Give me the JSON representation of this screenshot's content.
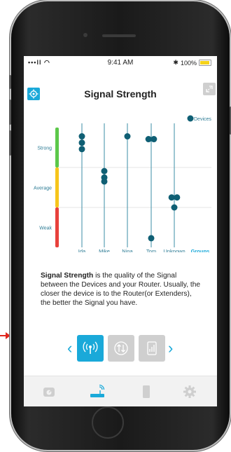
{
  "status_bar": {
    "signal": "•••ll ◠",
    "time": "9:41 AM",
    "bluetooth": "✱",
    "battery_text": "100%"
  },
  "header": {
    "title": "Signal Strength",
    "left_icon": "locate-icon",
    "right_icon": "expand-arrows-icon"
  },
  "legend": {
    "label": "Devices",
    "color": "#0f5f74"
  },
  "chart_data": {
    "type": "scatter",
    "x_categories": [
      "Ida",
      "Mike",
      "Nina",
      "Tom",
      "Unknown"
    ],
    "x_extra_label": "Groups",
    "y_categories": [
      "Weak",
      "Average",
      "Strong"
    ],
    "y_bands": [
      {
        "label": "Strong",
        "color": "#5cc84a"
      },
      {
        "label": "Average",
        "color": "#f6c51b"
      },
      {
        "label": "Weak",
        "color": "#e8413c"
      }
    ],
    "ylim": [
      0,
      3
    ],
    "points": [
      {
        "group": "Ida",
        "y": 2.78
      },
      {
        "group": "Ida",
        "y": 2.62
      },
      {
        "group": "Ida",
        "y": 2.46
      },
      {
        "group": "Mike",
        "y": 1.91
      },
      {
        "group": "Mike",
        "y": 1.75
      },
      {
        "group": "Mike",
        "y": 1.65
      },
      {
        "group": "Nina",
        "y": 2.78
      },
      {
        "group": "Tom",
        "y": 2.71,
        "dx": -0.12
      },
      {
        "group": "Tom",
        "y": 2.71,
        "dx": 0.12
      },
      {
        "group": "Tom",
        "y": 0.23
      },
      {
        "group": "Unknown",
        "y": 1.25,
        "dx": -0.12
      },
      {
        "group": "Unknown",
        "y": 1.25,
        "dx": 0.12
      },
      {
        "group": "Unknown",
        "y": 1.0
      }
    ],
    "marker_color": "#0f5f74",
    "grid": true
  },
  "description": {
    "bold": "Signal Strength",
    "text": " is the quality of the Signal between the Devices and your Router. Usually, the closer the device is to the Router(or Extenders), the better the Signal you have."
  },
  "mode_nav": {
    "prev": "‹",
    "next": "›",
    "buttons": [
      {
        "name": "signal-mode",
        "icon": "wifi-signal-icon",
        "active": true,
        "color": "#1aa9d9"
      },
      {
        "name": "speed-mode",
        "icon": "up-down-arrows-icon",
        "active": false,
        "color": "#cfcfcf"
      },
      {
        "name": "device-mode",
        "icon": "device-icon",
        "active": false,
        "color": "#cfcfcf"
      }
    ]
  },
  "tab_bar": [
    {
      "name": "tab-dashboard",
      "icon": "gauge-icon",
      "active": false
    },
    {
      "name": "tab-network",
      "icon": "router-icon",
      "active": true,
      "color": "#1aa9d9"
    },
    {
      "name": "tab-devices",
      "icon": "device-icon",
      "active": false
    },
    {
      "name": "tab-settings",
      "icon": "gear-icon",
      "active": false
    }
  ]
}
